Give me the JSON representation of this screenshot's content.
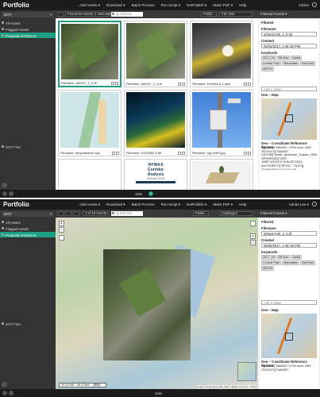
{
  "app": {
    "logo": "Portfolio"
  },
  "top": {
    "menu": [
      "Add Assets ▾",
      "Download ▾",
      "Batch Process",
      "Run Script ▾",
      "NetPublish ▾",
      "Make PDF ▾",
      "Help"
    ],
    "user1": "Adrian",
    "user2": "Adrian Lee ▾"
  },
  "side": {
    "catalog": "DOT",
    "items": [
      "All Assets",
      "Flagged Assets",
      "Proposal: NYW4A-8"
    ],
    "dot_files": "DOT Files"
  },
  "w1": {
    "found": "Found 54 Assets, 1 Selected",
    "search_placeholder": "QuickFind",
    "fields": "Fields ...",
    "sort": "File Size",
    "filtered_label": "Filtered Panels ▾",
    "cards": [
      {
        "cap": "Filename: a0NYC_2_5.tif"
      },
      {
        "cap": "Filename: a0NYC_2_5.tif"
      },
      {
        "cap": "Filename: NYW44-6-1.mp4"
      },
      {
        "cap": "Filename: mrnycta4ms0.xps"
      },
      {
        "cap": "Filename: NYM1BK-5.tiff"
      },
      {
        "cap": "Filename: nyy-MKR.jpg"
      },
      {
        "cap": ""
      },
      {
        "cap": ""
      },
      {
        "cap": ""
      }
    ],
    "doc_text": [
      "NYW4-6",
      "Corridor",
      "Analysis",
      "Summer 2018"
    ]
  },
  "w2": {
    "count": "1 of 19 Assets",
    "search_placeholder": "QuickFind",
    "fields": "Fields ...",
    "sort": "Cataloged",
    "filtered_label": "Filtered Panels ▾",
    "coord": "30.20768° -48.37968",
    "coord_btn": "GPS",
    "attribution": "Leaflet | Powered by Esri | Esri, HERE, DeLorme, USGS"
  },
  "panel": {
    "title": "Filtered",
    "filename_label": "Filename",
    "filename1": "a0NewYork_2_5.tid",
    "filename2": "a0NewYork_2_5.tif",
    "created_label": "Created",
    "created": "05/02/2017, 2:48 AM PM",
    "keywords_label": "Keywords",
    "keywords": [
      "2017_04",
      "5th Ave",
      "Aerial",
      "Central Park",
      "Manhattan",
      "NewYork",
      "MIDTN"
    ],
    "add_value": "Add a Value",
    "map_label": "Geo – Map",
    "crs_label": "Geo – Coordinate Reference System",
    "crs1": "PROJCS[\"NAD83 / UTM zone 18N\", GEOGCS[\"NAD83\", DATUM[\"North_American_Datum_1983\", SPHEROID[\"GRS 1980\",6378137,298.2572221, AUTHORITY[\"EPSG\",\"7019\"]], TOWGS84[0,0,0,0,0,0,0], AUTHORITY[\"EPSG\",\"6269\"]], PRIMEM[\"Greenwich\",0], AUTHORITY[\"EPSG\",\"8901\"]]",
    "crs2": "PROJCS[\"NAD83 / UTM zone 18N\", GEOGCS[\"NAD83\","
  },
  "footer": {
    "jobs": "Jobs",
    "badge": "0"
  }
}
